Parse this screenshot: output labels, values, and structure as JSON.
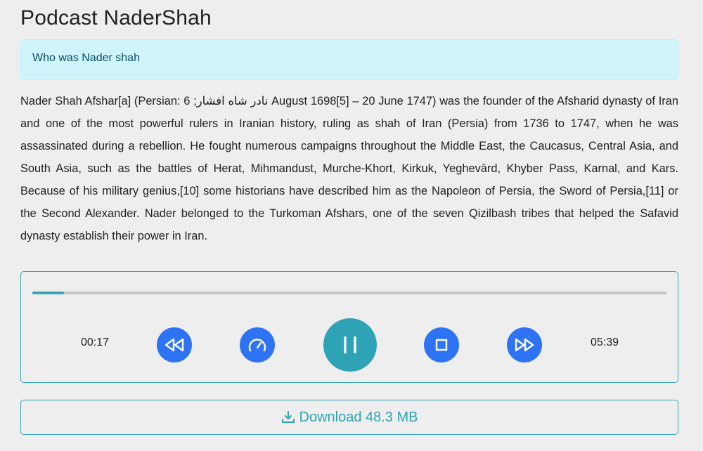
{
  "page": {
    "title": "Podcast NaderShah"
  },
  "alert": {
    "text": "Who was Nader shah"
  },
  "description": {
    "text": "Nader Shah Afshar[a] (Persian: نادر شاه افشار; 6 August 1698[5] – 20 June 1747) was the founder of the Afsharid dynasty of Iran and one of the most powerful rulers in Iranian history, ruling as shah of Iran (Persia) from 1736 to 1747, when he was assassinated during a rebellion. He fought numerous campaigns throughout the Middle East, the Caucasus, Central Asia, and South Asia, such as the battles of Herat, Mihmandust, Murche-Khort, Kirkuk, Yeghevārd, Khyber Pass, Karnal, and Kars. Because of his military genius,[10] some historians have described him as the Napoleon of Persia, the Sword of Persia,[11] or the Second Alexander. Nader belonged to the Turkoman Afshars, one of the seven Qizilbash tribes that helped the Safavid dynasty establish their power in Iran."
  },
  "player": {
    "current_time": "00:17",
    "total_time": "05:39",
    "progress_fraction": 0.05,
    "state": "playing",
    "controls": {
      "rewind_icon": "rewind-icon",
      "speed_icon": "speedometer-icon",
      "pause_icon": "pause-icon",
      "stop_icon": "stop-icon",
      "forward_icon": "fast-forward-icon"
    },
    "colors": {
      "accent": "#2ea3b5",
      "button_blue": "#2f73f5",
      "track": "#c4c4c4"
    }
  },
  "download": {
    "label": "Download 48.3 MB",
    "icon": "download-icon"
  }
}
